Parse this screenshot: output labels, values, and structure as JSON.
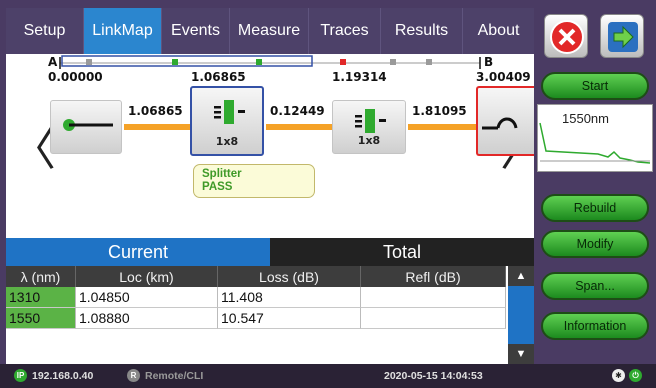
{
  "tabs": [
    {
      "label": "Setup",
      "active": false
    },
    {
      "label": "LinkMap",
      "active": true
    },
    {
      "label": "Events",
      "active": false
    },
    {
      "label": "Measure",
      "active": false
    },
    {
      "label": "Traces",
      "active": false
    },
    {
      "label": "Results",
      "active": false
    },
    {
      "label": "About",
      "active": false
    }
  ],
  "linkmap": {
    "marker_a": "A",
    "marker_b": "B",
    "distances": [
      "0.00000",
      "1.06865",
      "1.19314",
      "3.00409"
    ],
    "segment_lengths": [
      "1.06865",
      "0.12449",
      "1.81095"
    ],
    "events": [
      {
        "type": "launch",
        "label": ""
      },
      {
        "type": "splitter",
        "label": "1x8",
        "selected": true
      },
      {
        "type": "splitter",
        "label": "1x8",
        "selected": false
      },
      {
        "type": "end",
        "label": ""
      }
    ],
    "tooltip": {
      "line1": "Splitter",
      "line2": "PASS"
    },
    "nav_prev": "〈",
    "nav_next": "〉"
  },
  "result_tabs": {
    "current": "Current",
    "total": "Total"
  },
  "table": {
    "headers": [
      "λ (nm)",
      "Loc (km)",
      "Loss (dB)",
      "Refl (dB)"
    ],
    "rows": [
      [
        "1310",
        "1.04850",
        "11.408",
        ""
      ],
      [
        "1550",
        "1.08880",
        "10.547",
        ""
      ]
    ],
    "scroll_up": "▲",
    "scroll_down": "▼"
  },
  "side": {
    "start": "Start",
    "trace_label": "1550nm",
    "rebuild": "Rebuild",
    "modify": "Modify",
    "span": "Span...",
    "information": "Information"
  },
  "status": {
    "ip": "192.168.0.40",
    "remote": "Remote/CLI",
    "datetime": "2020-05-15  14:04:53"
  },
  "colors": {
    "accent": "#2b86cf",
    "fiber": "#f5a227",
    "launch_green": "#2faa2f",
    "button_green": "#36b034",
    "end_red": "#e22828"
  },
  "icons": {
    "close": "close-icon",
    "next": "arrow-right-icon",
    "launch": "launch-fiber-icon",
    "splitter": "splitter-icon",
    "end": "fiber-end-icon",
    "ip": "ip-icon",
    "remote": "remote-icon",
    "bluetooth": "bluetooth-icon",
    "power": "power-icon"
  }
}
